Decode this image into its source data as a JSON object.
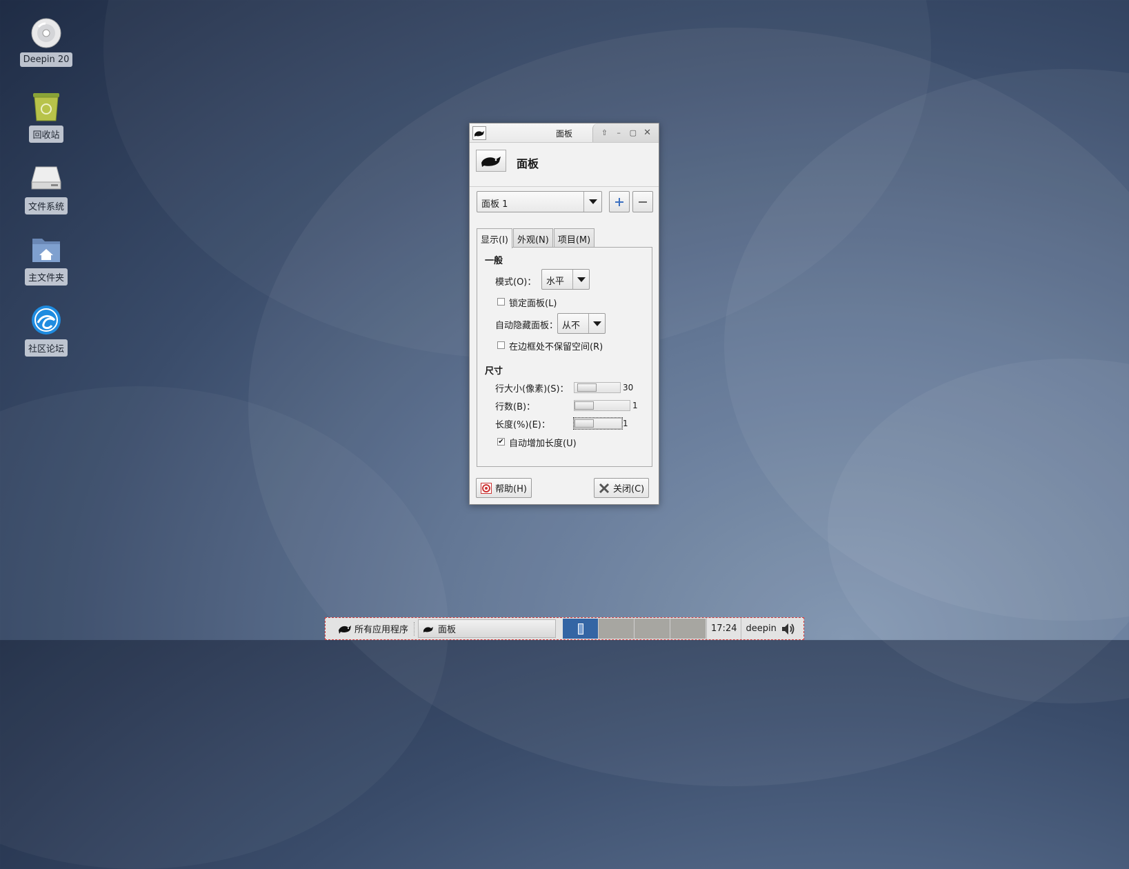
{
  "desktop": {
    "icons": [
      {
        "label": "Deepin 20",
        "icon": "disc-icon"
      },
      {
        "label": "回收站",
        "icon": "trash-icon"
      },
      {
        "label": "文件系统",
        "icon": "drive-icon"
      },
      {
        "label": "主文件夹",
        "icon": "home-folder-icon"
      },
      {
        "label": "社区论坛",
        "icon": "deepin-logo-icon"
      }
    ]
  },
  "dialog": {
    "window_title": "面板",
    "header_title": "面板",
    "panel_select": "面板 1",
    "tabs": [
      "显示(I)",
      "外观(N)",
      "项目(M)"
    ],
    "general": {
      "section": "一般",
      "mode_label": "模式(O)：",
      "mode_value": "水平",
      "lock_label": "锁定面板(L)",
      "lock_checked": false,
      "autohide_label": "自动隐藏面板：",
      "autohide_value": "从不",
      "reserve_label": "在边框处不保留空间(R)",
      "reserve_checked": false
    },
    "size": {
      "section": "尺寸",
      "row_size_label": "行大小(像素)(S)：",
      "row_size_value": "30",
      "rows_label": "行数(B)：",
      "rows_value": "1",
      "length_label": "长度(%)(E)：",
      "length_value": "1",
      "auto_length_label": "自动增加长度(U)",
      "auto_length_checked": true
    },
    "help_button": "帮助(H)",
    "close_button": "关闭(C)"
  },
  "taskbar": {
    "apps_label": "所有应用程序",
    "task_label": "面板",
    "clock": "17:24",
    "user": "deepin"
  },
  "colors": {
    "workspace_active": "#3465a4",
    "taskbar_border": "#d83a3a"
  }
}
